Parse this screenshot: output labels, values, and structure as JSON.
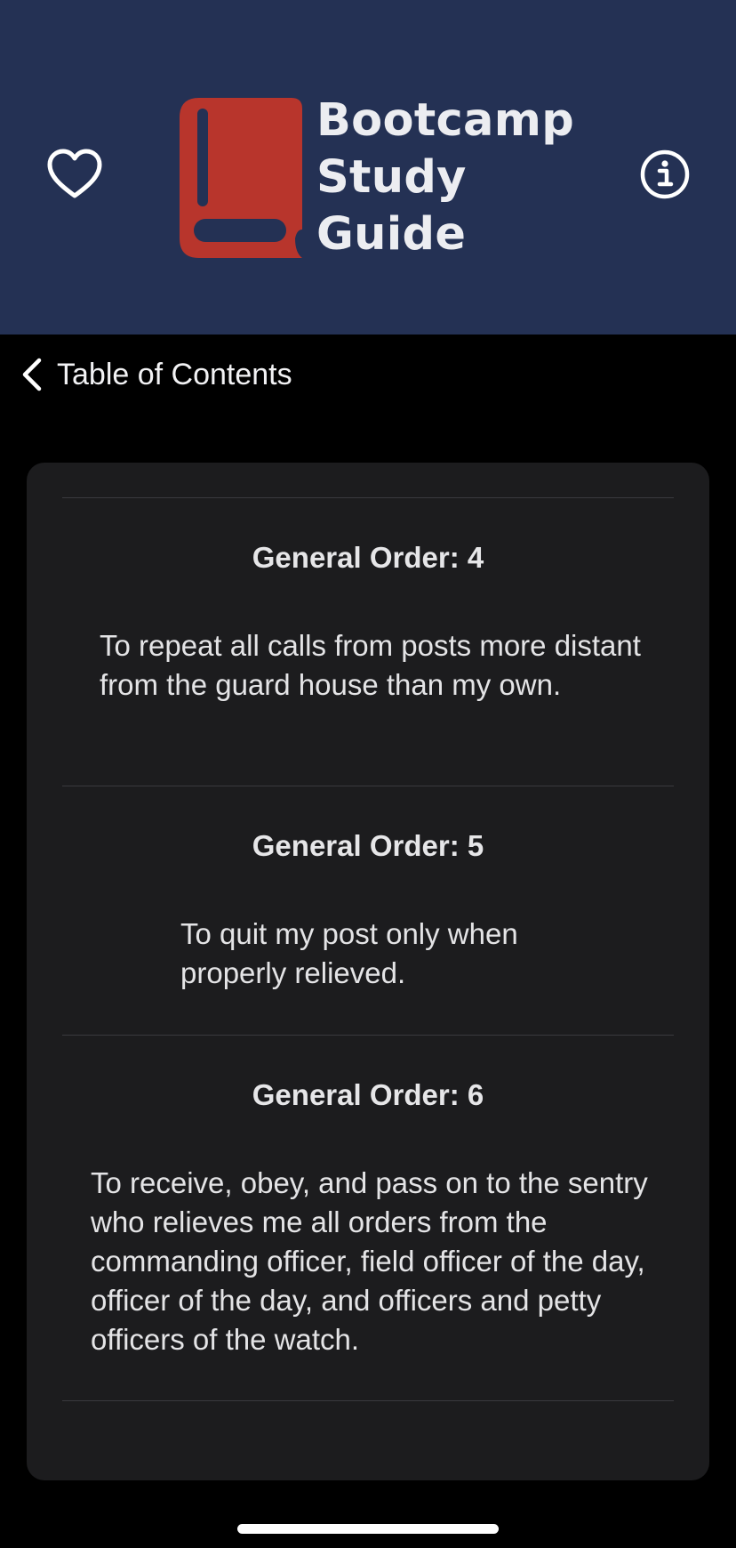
{
  "app": {
    "title_lines": [
      "Bootcamp",
      "Study",
      "Guide"
    ],
    "icons": {
      "favorite": "heart-outline-icon",
      "info": "info-circle-icon",
      "logo": "book-icon",
      "back": "chevron-left-icon"
    },
    "colors": {
      "header_bg": "#243154",
      "logo": "#b8352c",
      "card_bg": "#1c1c1e",
      "page_bg": "#000000"
    }
  },
  "nav": {
    "back_label": "Table of Contents"
  },
  "orders": [
    {
      "title": "General Order: 4",
      "text": "To repeat all calls from posts more distant from the guard house than my own."
    },
    {
      "title": "General Order: 5",
      "text": "To quit my post only when properly relieved."
    },
    {
      "title": "General Order: 6",
      "text": "To receive, obey, and pass on to the sentry who relieves me all orders from the commanding officer, field officer of the day, officer of the day, and officers and petty officers of the watch."
    }
  ]
}
